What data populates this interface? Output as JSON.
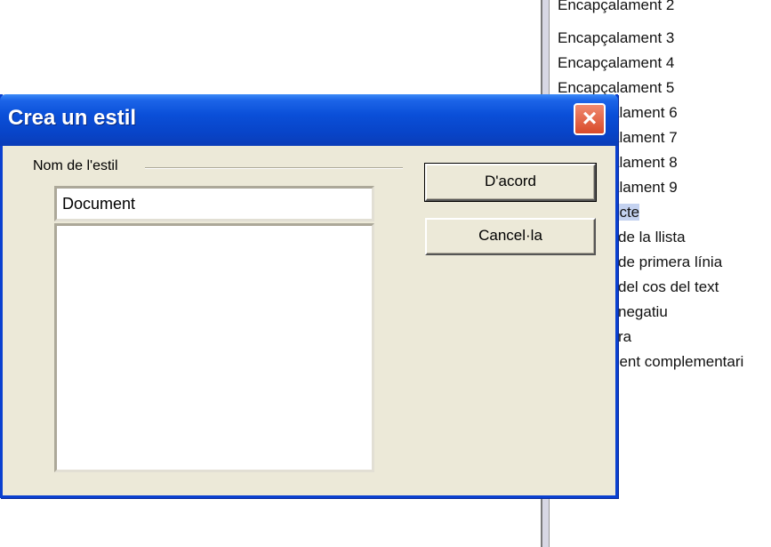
{
  "background_list": {
    "items": [
      {
        "label": "Encapçalament 2",
        "selected": false
      },
      {
        "label": "Encapçalament 3",
        "selected": false
      },
      {
        "label": "Encapçalament 4",
        "selected": false
      },
      {
        "label": "Encapçalament 5",
        "selected": false
      },
      {
        "label": "alament 6",
        "selected": false
      },
      {
        "label": "alament 7",
        "selected": false
      },
      {
        "label": "alament 8",
        "selected": false
      },
      {
        "label": "alament 9",
        "selected": false
      },
      {
        "label": "ecte",
        "selected": true
      },
      {
        "label": "de la llista",
        "selected": false
      },
      {
        "label": "de primera línia",
        "selected": false
      },
      {
        "label": "del cos del text",
        "selected": false
      },
      {
        "label": "negatiu",
        "selected": false
      },
      {
        "label": "ra",
        "selected": false
      },
      {
        "label": "nent complementari",
        "selected": false
      }
    ]
  },
  "dialog": {
    "title": "Crea un estil",
    "close_icon": "close-icon",
    "group_label": "Nom de l'estil",
    "style_name_value": "Document",
    "ok_label": "D'acord",
    "cancel_label": "Cancel·la"
  }
}
